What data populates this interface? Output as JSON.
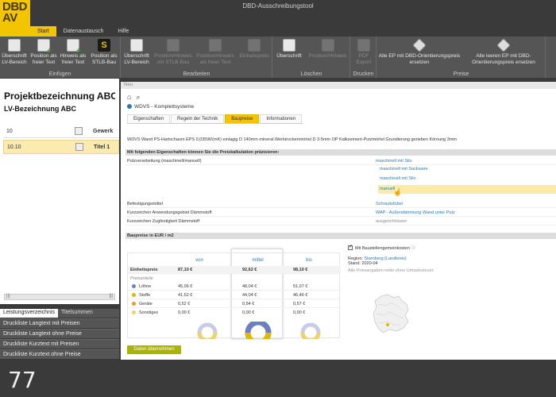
{
  "app": {
    "title": "DBD-Ausschreibungstool",
    "logo_line1": "DBD",
    "logo_line2": "AV"
  },
  "ribbon_tabs": [
    {
      "label": "Start",
      "active": true
    },
    {
      "label": "Datenaustausch",
      "active": false
    },
    {
      "label": "Hilfe",
      "active": false
    }
  ],
  "ribbon": {
    "groups": {
      "einfuegen": "Einfügen",
      "bearbeiten": "Bearbeiten",
      "loeschen": "Löschen",
      "drucken": "Drucken",
      "preise": "Preise"
    },
    "buttons": {
      "ueberschrift_lv": "Überschrift LV-Bereich",
      "position_freier_text": "Position als freier Text",
      "hinweis_freier_text": "Hinweis als freier Text",
      "position_stlb": "Position als STLB-Bau",
      "ueberschrift_lv_edit": "Überschrift LV-Bereich",
      "pos_hinweis_stlb": "Position/Hinweis mit STLB-Bau",
      "pos_hinweis_freitext": "Position/Hinweis als freier Text",
      "einheitspreis": "Einheitspreis",
      "ueberschrift_del": "Überschrift",
      "pos_hinweis_del": "Position/Hinweis",
      "pdf_export": "PDF Export",
      "alle_ep_ersetzen": "Alle EP mit DBD-Orientierungspreis ersetzen",
      "alle_leeren_ep_ersetzen": "Alle leeren EP mit DBD-Orientierungspreis ersetzen"
    }
  },
  "left": {
    "project_title": "Projektbezeichnung ABC",
    "lv_title": "LV-Bezeichnung ABC",
    "rows": [
      {
        "num": "10",
        "title": "Gewerk",
        "selected": false
      },
      {
        "num": "10.10",
        "title": "Titel 1",
        "selected": true
      }
    ],
    "scroll_left": "|||",
    "scroll_right": "|||",
    "tabs": [
      {
        "label": "Leistungsverzeichnis",
        "active": true
      },
      {
        "label": "Titelsummen",
        "active": false
      }
    ],
    "print_buttons": [
      "Druckliste Langtext mit Preisen",
      "Druckliste Langtext ohne Preise",
      "Druckliste Kurztext mit Preisen",
      "Druckliste Kurztext ohne Preise"
    ],
    "page_number": "77"
  },
  "main": {
    "header": "Neu",
    "home_icon": "⌂",
    "search_icon": "⌕",
    "breadcrumb": "WDVS - Komplettsysteme",
    "content_tabs": [
      {
        "label": "Eigenschaften",
        "active": false
      },
      {
        "label": "Regeln der Technik",
        "active": false
      },
      {
        "label": "Baupreise",
        "active": true
      },
      {
        "label": "Informationen",
        "active": false
      }
    ],
    "description": "WDVS Wand PS-Hartschaum EPS 0,035W/(mK) einlagig D 140mm mineral.Werktrockenmörtel D 3-5mm OP Kalkzement-Putzmörtel Grundierung gerieben Körnung 3mm",
    "section_props_title": "Mit folgenden Eigenschaften können Sie die Preiskalkulation präzisieren:",
    "properties": [
      {
        "label": "Putzverarbeitung (maschinell/manuell)",
        "value": "maschinell mit Silo",
        "muted": false
      },
      {
        "label": "Befestigungsmittel",
        "value": "Schraubdübel",
        "muted": false
      },
      {
        "label": "Kurzzeichen Anwendungsgebiet Dämmstoff",
        "value": "WAP - Außendämmung Wand unter Putz",
        "muted": false
      },
      {
        "label": "Kurzzeichen Zugfestigkeit Dämmstoff",
        "value": "ausgeschlossen",
        "muted": true
      }
    ],
    "options": [
      "maschinell mit Sackware",
      "maschinell mit Silo",
      "manuell"
    ],
    "section_prices_title": "Baupreise in EUR / m2",
    "price_cols": {
      "von": "von",
      "mittel": "mittel",
      "bis": "bis"
    },
    "einheitspreis": {
      "label": "Einheitspreis",
      "von": "87,10 €",
      "mittel": "92,62 €",
      "bis": "98,10 €"
    },
    "preisanteile_label": "Preisanteile",
    "breakdown": [
      {
        "label": "Löhne",
        "color": "#6b7fc1",
        "von": "45,06 €",
        "mittel": "48,04 €",
        "bis": "51,07 €"
      },
      {
        "label": "Stoffe",
        "color": "#e0b800",
        "von": "41,52 €",
        "mittel": "44,04 €",
        "bis": "46,46 €"
      },
      {
        "label": "Geräte",
        "color": "#e69a2e",
        "von": "0,52 €",
        "mittel": "0,54 €",
        "bis": "0,57 €"
      },
      {
        "label": "Sonstiges",
        "color": "#f2d16b",
        "von": "0,00 €",
        "mittel": "0,00 €",
        "bis": "0,00 €"
      }
    ],
    "region": {
      "checkbox_label": "Mit Baustellengemeinkosten",
      "info_icon": "ⓘ",
      "region_label": "Region:",
      "region_value": "Starnberg (Landkreis)",
      "stand": "Stand: 2020-04",
      "note": "Alle Preisangaben netto ohne Umsatzsteuer."
    },
    "apply_button": "Daten übernehmen"
  }
}
